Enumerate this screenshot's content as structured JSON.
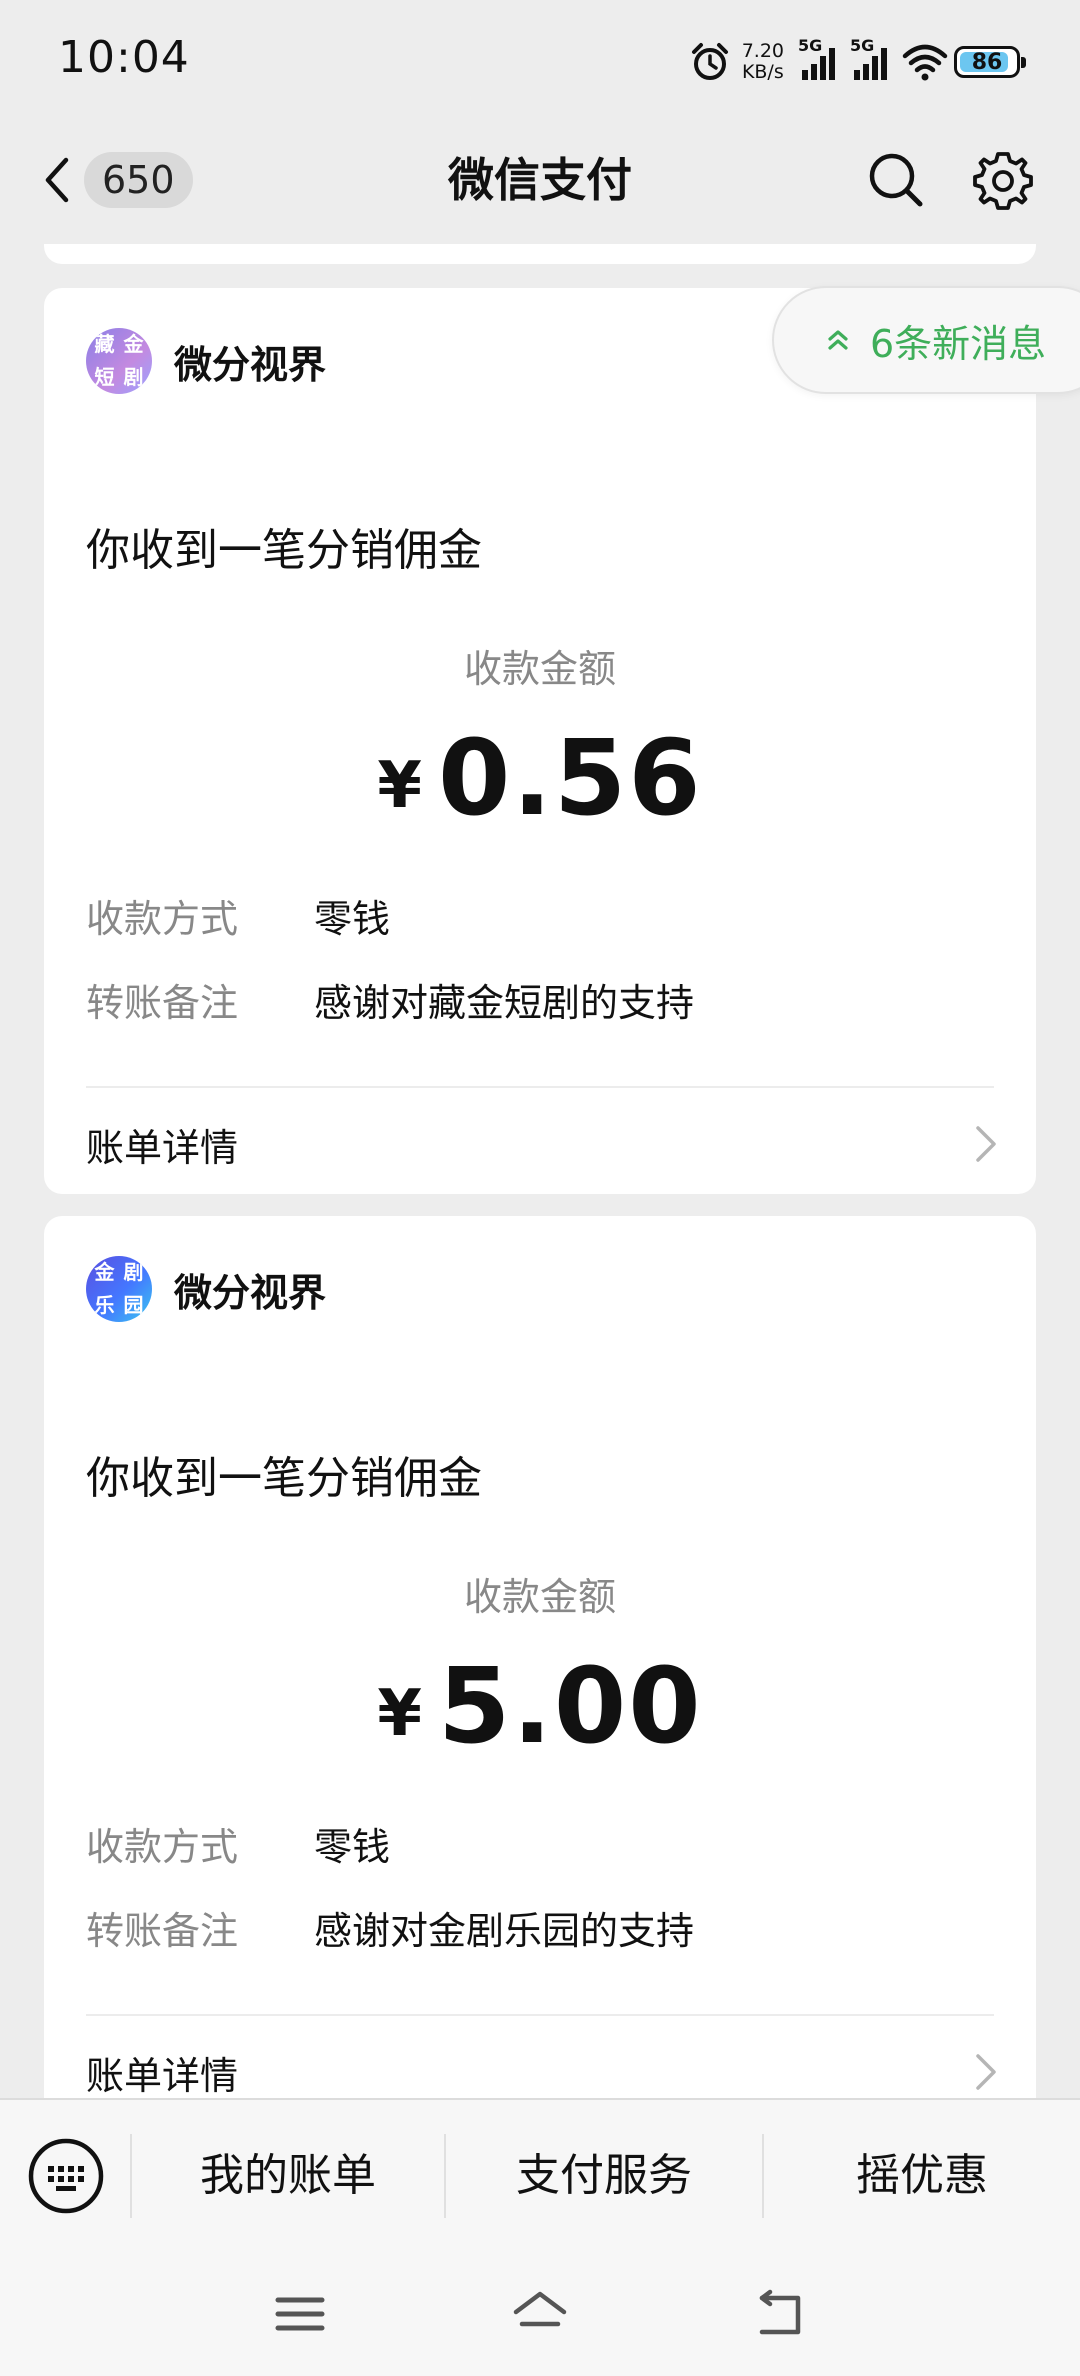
{
  "status_bar": {
    "time": "10:04",
    "speed_value": "7.20",
    "speed_unit": "KB/s",
    "sim1_label": "5G",
    "sim2_label": "5G",
    "battery": "86"
  },
  "nav": {
    "unread_count": "650",
    "title": "微信支付"
  },
  "new_messages": "6条新消息",
  "cards": [
    {
      "avatar_chars": [
        "藏",
        "金",
        "短",
        "剧"
      ],
      "sender": "微分视界",
      "title": "你收到一笔分销佣金",
      "amount_label": "收款金额",
      "currency": "¥",
      "amount": "0.56",
      "rows": [
        {
          "key": "收款方式",
          "value": "零钱"
        },
        {
          "key": "转账备注",
          "value": "感谢对藏金短剧的支持"
        }
      ],
      "detail_label": "账单详情"
    },
    {
      "avatar_chars": [
        "金",
        "剧",
        "乐",
        "园"
      ],
      "sender": "微分视界",
      "title": "你收到一笔分销佣金",
      "amount_label": "收款金额",
      "currency": "¥",
      "amount": "5.00",
      "rows": [
        {
          "key": "收款方式",
          "value": "零钱"
        },
        {
          "key": "转账备注",
          "value": "感谢对金剧乐园的支持"
        }
      ],
      "detail_label": "账单详情"
    }
  ],
  "bottom_menu": {
    "items": [
      "我的账单",
      "支付服务",
      "摇优惠"
    ]
  },
  "colors": {
    "background": "#ededed",
    "card": "#ffffff",
    "accent_green": "#3fae5a",
    "muted_text": "#888888"
  }
}
